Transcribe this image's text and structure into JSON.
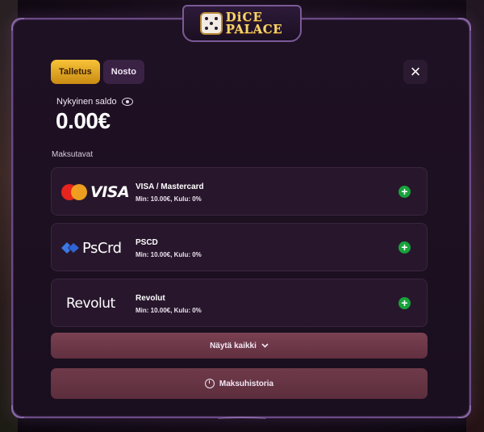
{
  "brand": {
    "line1": "DiCE",
    "line2": "PALACE"
  },
  "tabs": [
    {
      "label": "Talletus",
      "active": true
    },
    {
      "label": "Nosto",
      "active": false
    }
  ],
  "close_label": "×",
  "balance": {
    "label": "Nykyinen saldo",
    "value": "0.00€"
  },
  "methods_label": "Maksutavat",
  "methods": [
    {
      "logo_text": "VISA",
      "name": "VISA / Mastercard",
      "meta": "Min: 10.00€, Kulu: 0%"
    },
    {
      "logo_text": "PsCrd",
      "name": "PSCD",
      "meta": "Min: 10.00€, Kulu: 0%"
    },
    {
      "logo_text": "Revolut",
      "name": "Revolut",
      "meta": "Min: 10.00€, Kulu: 0%"
    }
  ],
  "show_all_label": "Näytä kaikki",
  "history_label": "Maksuhistoria",
  "colors": {
    "accent_gold": "#f7c338",
    "plus_green": "#18a23b",
    "button_rose": "#7a4152",
    "border_purple": "#6b4a86"
  },
  "icons": {
    "eye": "eye-icon",
    "plus": "plus-icon",
    "chevron": "chevron-down-icon",
    "history": "history-clock-icon",
    "close": "close-icon"
  }
}
